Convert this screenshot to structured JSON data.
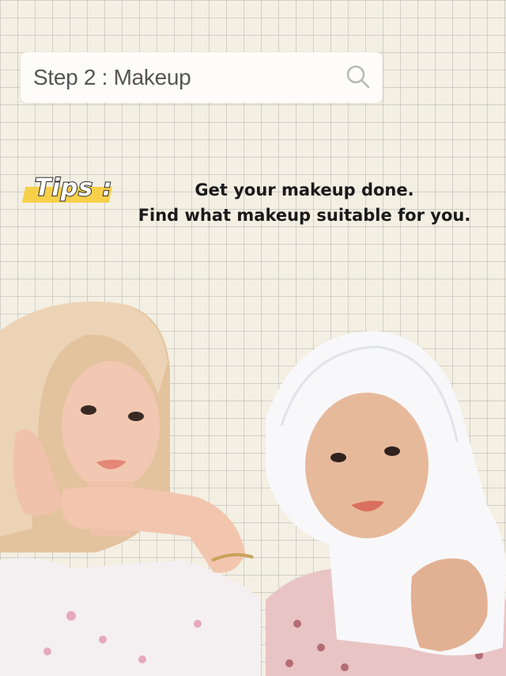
{
  "search": {
    "query": "Step 2 : Makeup",
    "icon": "search-icon"
  },
  "tips": {
    "label": "Tips :",
    "line1": "Get your makeup done.",
    "line2": "Find what makeup suitable for you."
  },
  "colors": {
    "background": "#f3efe3",
    "highlight": "#f7d04a",
    "hijab_left": "#e8c9a6",
    "hijab_right": "#ffffff"
  }
}
